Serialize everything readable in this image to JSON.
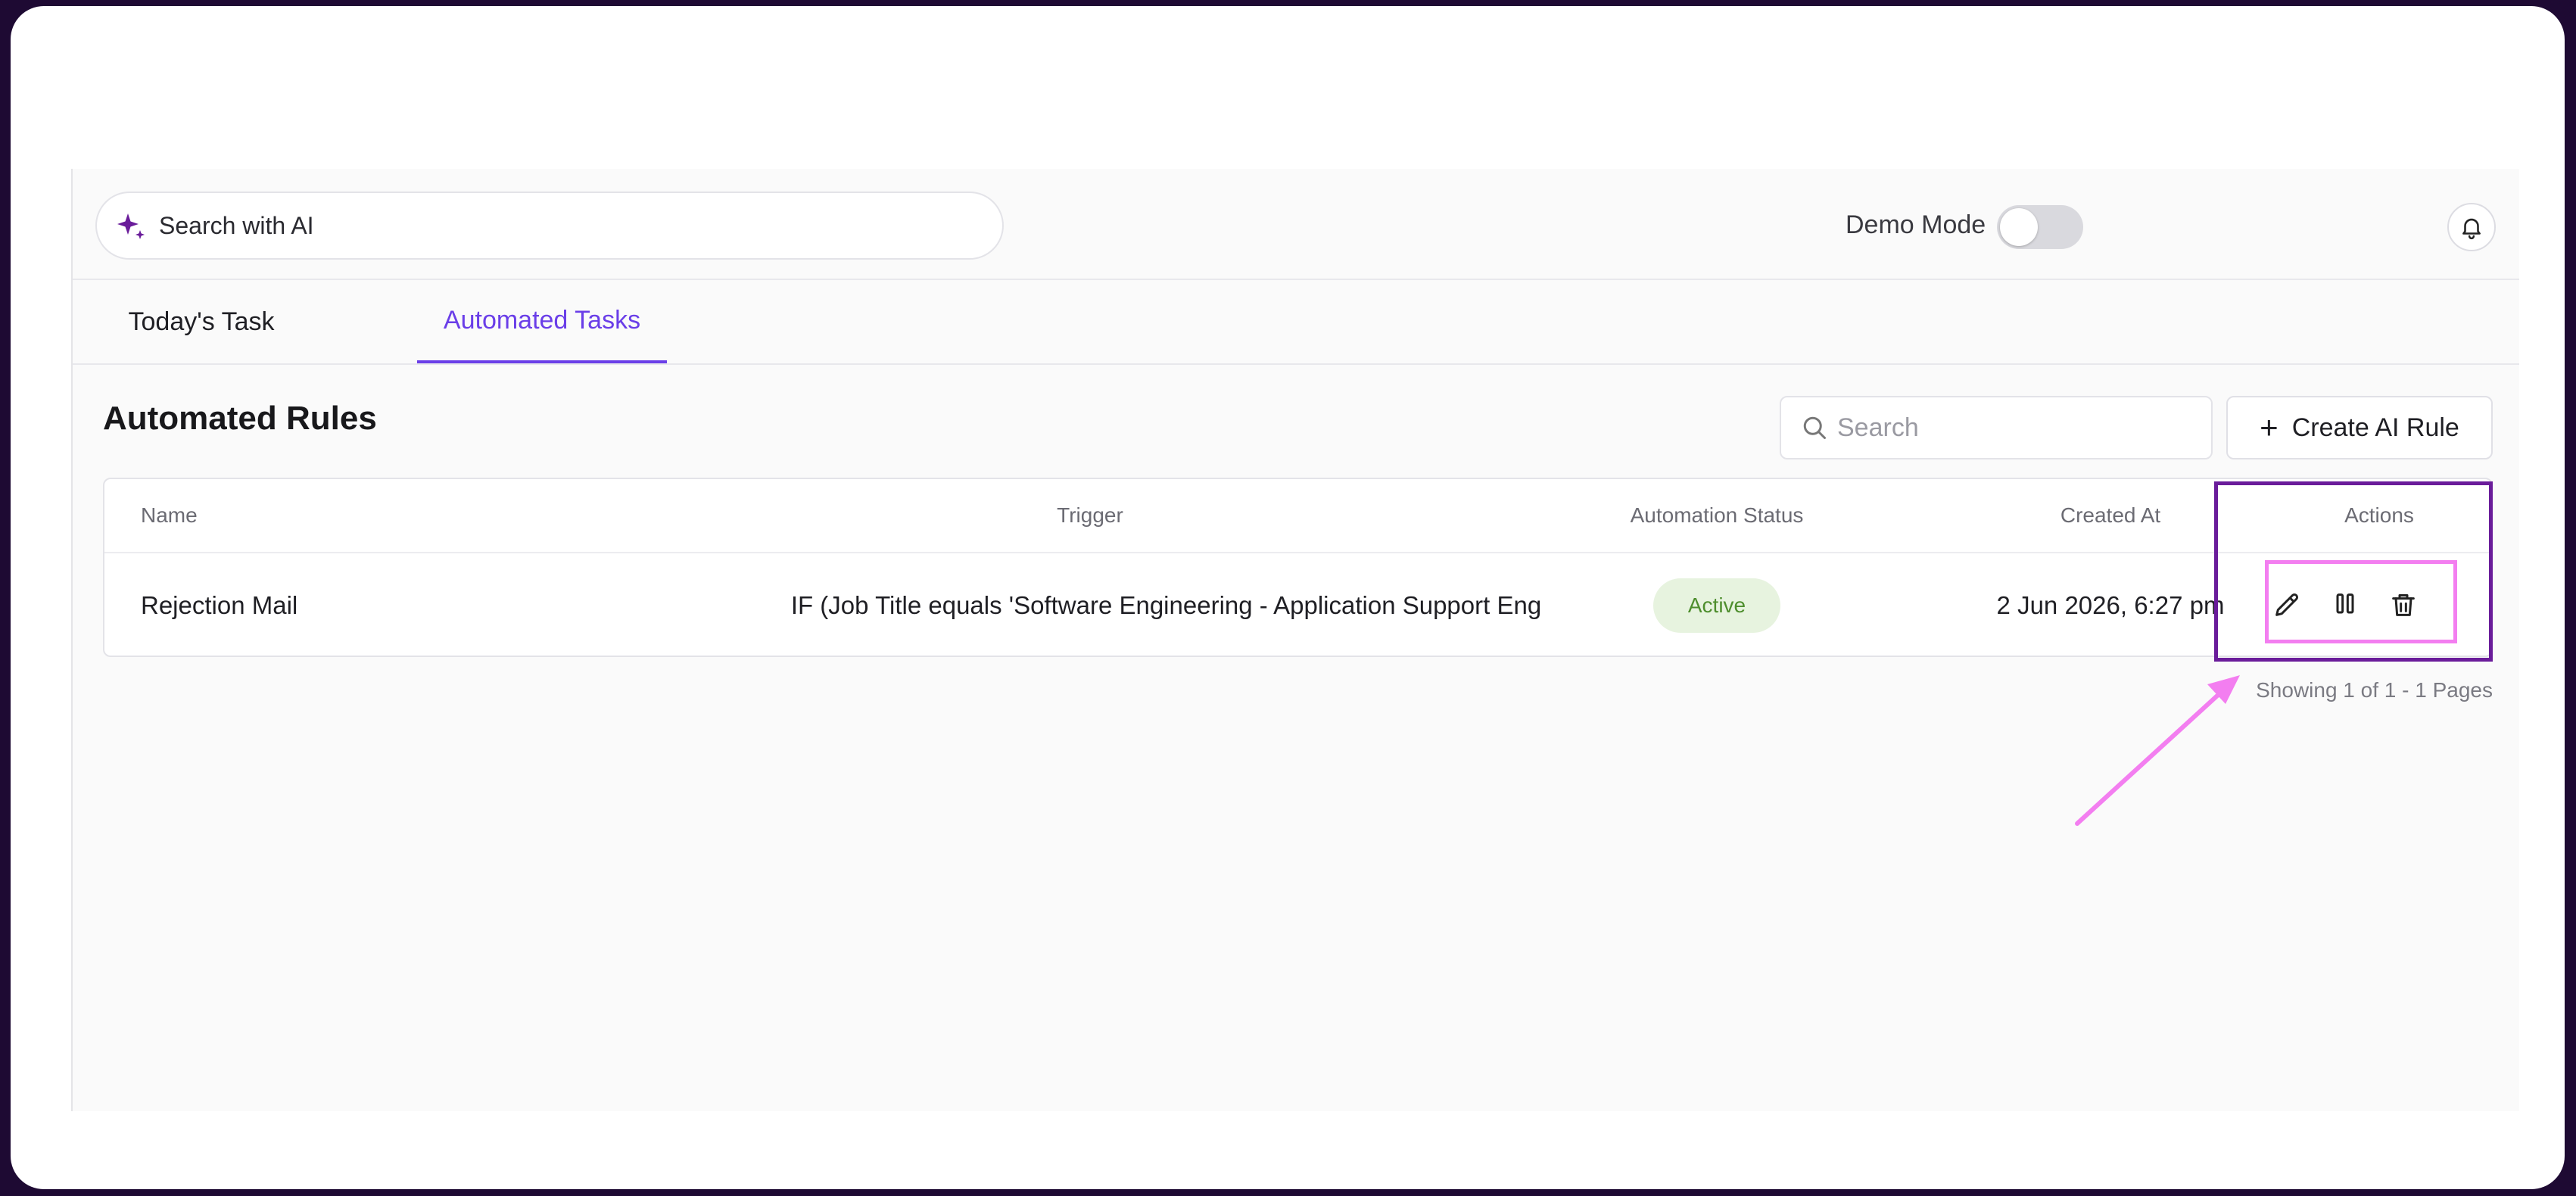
{
  "header": {
    "ai_search_label": "Search with AI",
    "demo_mode_label": "Demo Mode",
    "demo_mode_on": false
  },
  "tabs": [
    {
      "label": "Today's Task",
      "active": false
    },
    {
      "label": "Automated Tasks",
      "active": true
    }
  ],
  "main": {
    "title": "Automated Rules",
    "search_placeholder": "Search",
    "create_button_label": "Create AI Rule"
  },
  "table": {
    "columns": [
      "Name",
      "Trigger",
      "Automation Status",
      "Created At",
      "Actions"
    ],
    "rows": [
      {
        "name": "Rejection Mail",
        "trigger": "IF (Job Title equals 'Software Engineering - Application Support Eng",
        "status": "Active",
        "created_at": "2 Jun 2026, 6:27 pm"
      }
    ],
    "actions": [
      "pencil-icon",
      "pause-icon",
      "trash-icon"
    ]
  },
  "pagination": {
    "text": "Showing 1 of 1 - 1 Pages"
  },
  "colors": {
    "accent": "#6a3ee8",
    "highlight_outer": "#6a1c9a",
    "highlight_inner": "#f37ef0",
    "status_bg": "#e7f3df",
    "status_text": "#4e8e2d"
  }
}
